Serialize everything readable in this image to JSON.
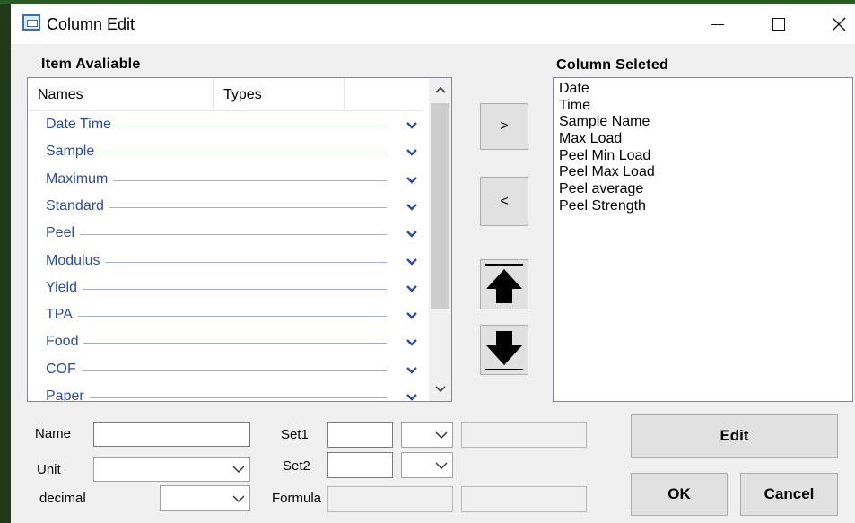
{
  "window": {
    "title": "Column Edit"
  },
  "colors": {
    "item_text": "#2b4ca0",
    "accent_line": "#9fb0d6"
  },
  "items_available": {
    "title": "Item Avaliable",
    "columns": [
      "Names",
      "Types"
    ],
    "rows": [
      "Date Time",
      "Sample",
      "Maximum",
      "Standard",
      "Peel",
      "Modulus",
      "Yield",
      "TPA",
      "Food",
      "COF",
      "Paper"
    ]
  },
  "column_selected": {
    "title": "Column Seleted",
    "items": [
      "Date",
      "Time",
      "Sample Name",
      "Max Load",
      "Peel Min Load",
      "Peel Max Load",
      "Peel average",
      "Peel Strength"
    ]
  },
  "buttons": {
    "add": ">",
    "remove": "<",
    "edit": "Edit",
    "ok": "OK",
    "cancel": "Cancel"
  },
  "form": {
    "name_label": "Name",
    "unit_label": "Unit",
    "decimal_label": "decimal",
    "set1_label": "Set1",
    "set2_label": "Set2",
    "formula_label": "Formula",
    "name_value": "",
    "unit_value": "",
    "decimal_value": "",
    "set1_value": "",
    "set1_option": "",
    "set1_extra": "",
    "set2_value": "",
    "set2_option": "",
    "formula_value": "",
    "formula_extra": ""
  },
  "icons": {
    "app": "window-app-icon",
    "minimize": "minimize-icon",
    "maximize": "maximize-icon",
    "close": "close-icon",
    "row_dropdown": "chevron-down-icon",
    "move_up": "arrow-up-icon",
    "move_down": "arrow-down-icon"
  }
}
